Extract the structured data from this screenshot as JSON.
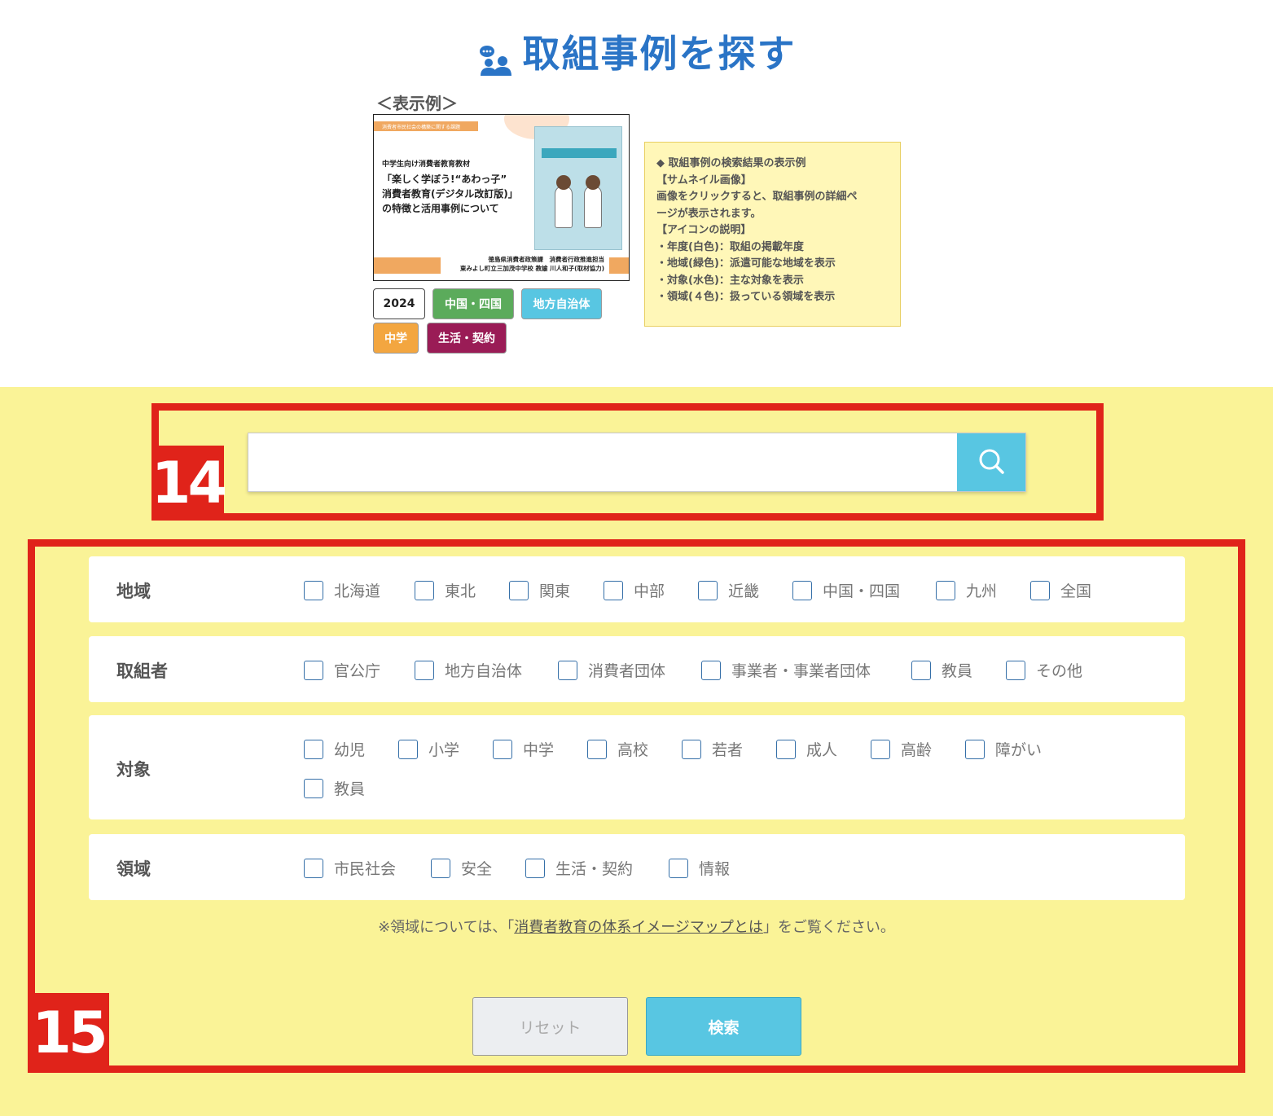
{
  "header": {
    "title": "取組事例を探す",
    "icon": "people-chat-icon"
  },
  "example": {
    "label": "＜表示例＞",
    "thumbnail": {
      "band_text": "消費者市民社会の構築に関する課題",
      "lines": [
        "中学生向け消費者教育教材",
        "「楽しく学ぼう!“あわっ子”",
        "消費者教育(デジタル改訂版)」",
        "の特徴と活用事例について"
      ],
      "footer": [
        "徳島県消費者政策課　消費者行政推進担当",
        "東みよし町立三加茂中学校 教諭 川人和子(取材協力)"
      ]
    },
    "tags": [
      "2024",
      "中国・四国",
      "地方自治体",
      "中学",
      "生活・契約"
    ],
    "info": {
      "heading": "◆ 取組事例の検索結果の表示例",
      "lines": [
        "【サムネイル画像】",
        "画像をクリックすると、取組事例の詳細ペ",
        "ージが表示されます。",
        "【アイコンの説明】",
        "・年度(白色)：取組の掲載年度",
        "・地域(緑色)：派遣可能な地域を表示",
        "・対象(水色)：主な対象を表示",
        "・領域(４色)：扱っている領域を表示"
      ]
    }
  },
  "search": {
    "value": "",
    "placeholder": "",
    "button_icon": "search-icon"
  },
  "filters": {
    "region": {
      "label": "地域",
      "options": [
        "北海道",
        "東北",
        "関東",
        "中部",
        "近畿",
        "中国・四国",
        "九州",
        "全国"
      ]
    },
    "actor": {
      "label": "取組者",
      "options": [
        "官公庁",
        "地方自治体",
        "消費者団体",
        "事業者・事業者団体",
        "教員",
        "その他"
      ]
    },
    "target": {
      "label": "対象",
      "options": [
        "幼児",
        "小学",
        "中学",
        "高校",
        "若者",
        "成人",
        "高齢",
        "障がい",
        "教員"
      ]
    },
    "domain": {
      "label": "領域",
      "options": [
        "市民社会",
        "安全",
        "生活・契約",
        "情報"
      ]
    }
  },
  "note": {
    "prefix": "※領域については、「",
    "link": "消費者教育の体系イメージマップとは",
    "suffix": "」をご覧ください。"
  },
  "buttons": {
    "reset": "リセット",
    "search": "検索"
  },
  "annotations": [
    "14",
    "15"
  ],
  "colors": {
    "accent": "#2a74c6",
    "search": "#58c6e2",
    "annotation": "#e0231a",
    "background": "#faf397"
  }
}
